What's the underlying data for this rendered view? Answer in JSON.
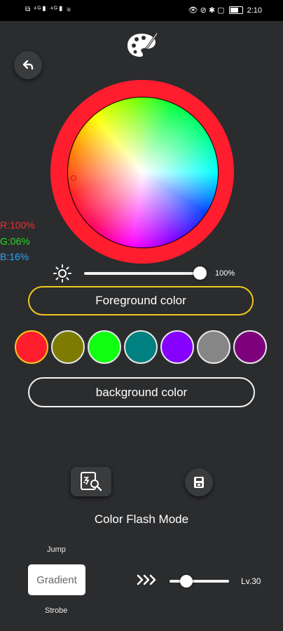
{
  "status_bar": {
    "left": "⧉ ⁴ᴳ▮ ⁴ᴳ▮ ≋",
    "right_icons": "👁 ⊘ ✱ ▢",
    "time": "2:10"
  },
  "icons": {
    "palette": "palette-icon",
    "back": "back-arrow-icon",
    "brightness": "sun-icon",
    "flash_mode": "flash-mode-icon",
    "save": "save-icon",
    "speed": "chevrons-right-icon"
  },
  "color_wheel": {
    "ring_color": "#ff1d2e"
  },
  "rgb": {
    "r": "R:100%",
    "g": "G:06%",
    "b": "B:16%"
  },
  "brightness": {
    "value": "100%",
    "level": 1.0
  },
  "buttons": {
    "foreground": "Foreground color",
    "background": "background color"
  },
  "swatches": [
    "#ff1d2e",
    "#7d7c00",
    "#11ff11",
    "#008080",
    "#8500ff",
    "#868686",
    "#7d007d"
  ],
  "mode": {
    "title": "Color Flash Mode"
  },
  "effects": {
    "jump": "Jump",
    "gradient": "Gradient",
    "strobe": "Strobe"
  },
  "speed": {
    "level": "Lv.30",
    "value": 0.3
  },
  "accent_color": "#f0c81e"
}
